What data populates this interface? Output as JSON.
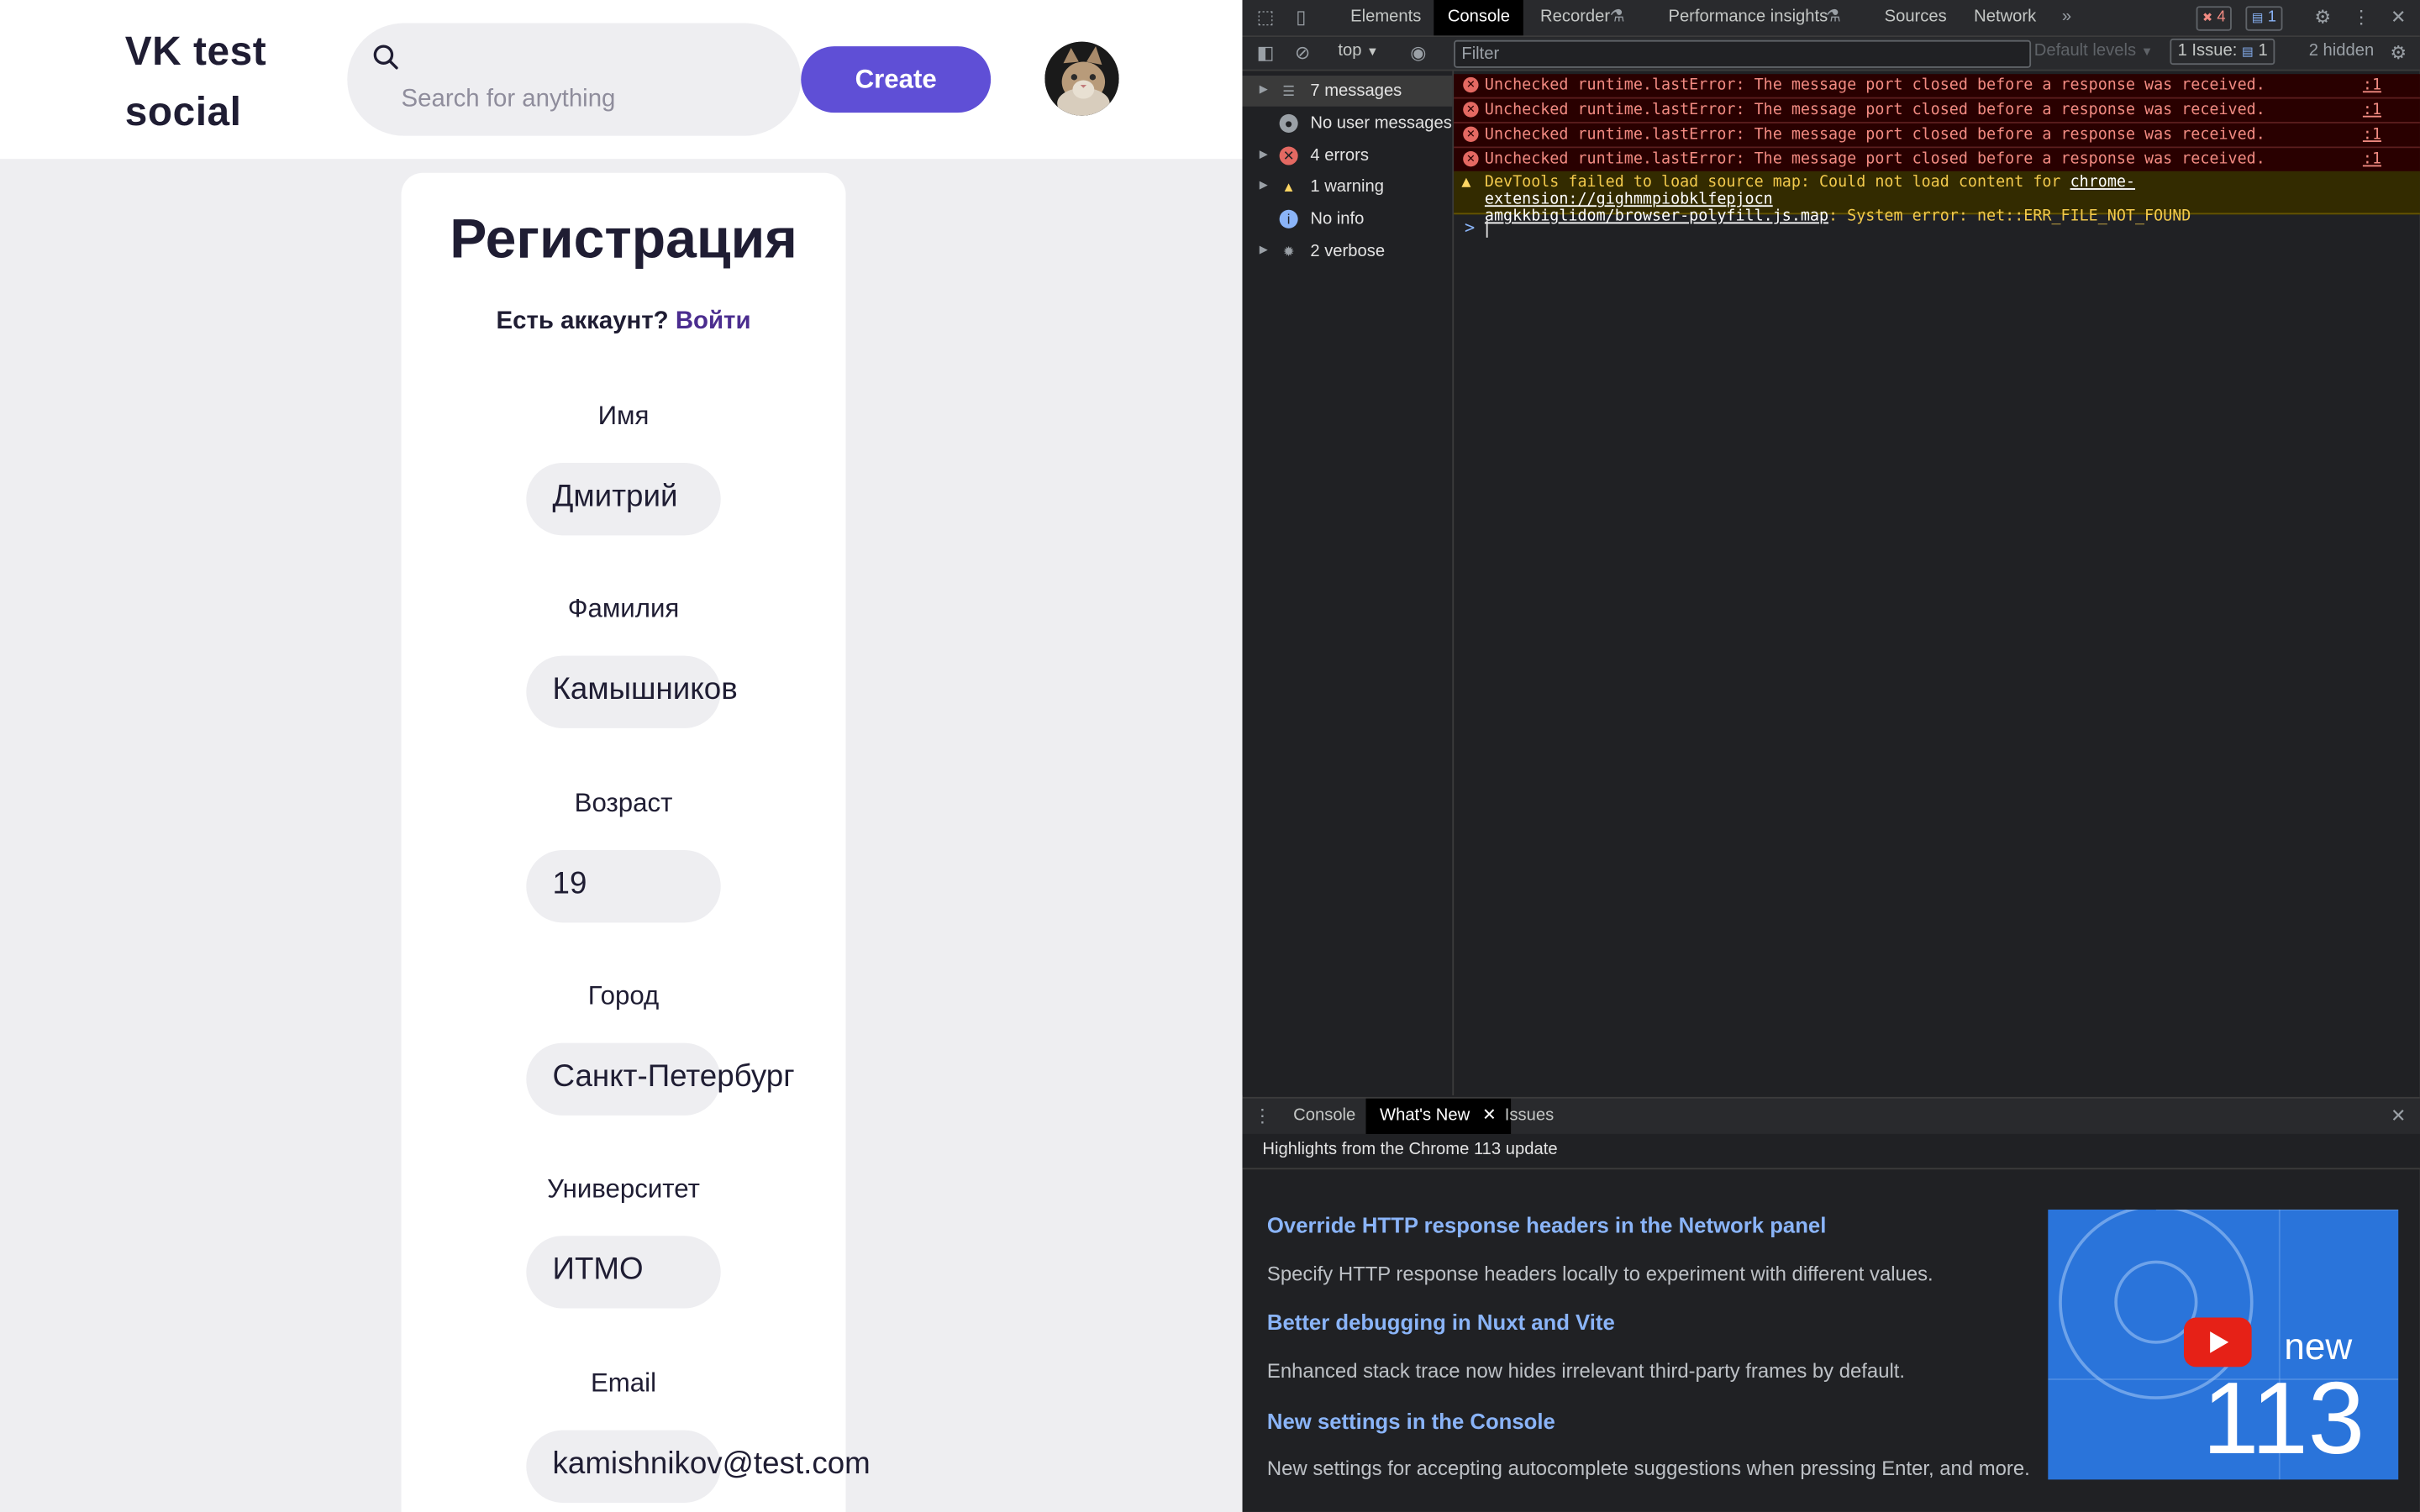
{
  "app": {
    "logo_line1": "VK test",
    "logo_line2": "social",
    "search_placeholder": "Search for anything",
    "create_label": "Create"
  },
  "registration": {
    "title": "Регистрация",
    "have_account": "Есть аккаунт?",
    "login_link": "Войти",
    "fields": [
      {
        "label": "Имя",
        "value": "Дмитрий"
      },
      {
        "label": "Фамилия",
        "value": "Камышников"
      },
      {
        "label": "Возраст",
        "value": "19"
      },
      {
        "label": "Город",
        "value": "Санкт-Петербург"
      },
      {
        "label": "Университет",
        "value": "ИТМО"
      },
      {
        "label": "Email",
        "value": "kamishnikov@test.com"
      }
    ]
  },
  "devtools": {
    "tabs": [
      "Elements",
      "Console",
      "Recorder",
      "Performance insights",
      "Sources",
      "Network"
    ],
    "more": "»",
    "error_count": "4",
    "message_count": "1",
    "context": "top",
    "filter_placeholder": "Filter",
    "levels": "Default levels",
    "issues_label": "1 Issue:",
    "issues_count": "1",
    "hidden": "2 hidden",
    "sidebar": [
      {
        "label": "7 messages",
        "icon": "list-icon"
      },
      {
        "label": "No user messages",
        "icon": "user-icon"
      },
      {
        "label": "4 errors",
        "icon": "error-icon"
      },
      {
        "label": "1 warning",
        "icon": "warning-icon"
      },
      {
        "label": "No info",
        "icon": "info-icon"
      },
      {
        "label": "2 verbose",
        "icon": "bug-icon"
      }
    ],
    "errors": [
      "Unchecked runtime.lastError: The message port closed before a response was received.",
      "Unchecked runtime.lastError: The message port closed before a response was received.",
      "Unchecked runtime.lastError: The message port closed before a response was received.",
      "Unchecked runtime.lastError: The message port closed before a response was received."
    ],
    "error_source": ":1",
    "warning_prefix": "DevTools failed to load source map: Could not load content for",
    "warning_link_1": "chrome-extension://gighmmpiobklfepjocn",
    "warning_link_2": "amgkkbiglidom/browser-polyfill.js.map",
    "warning_suffix": ": System error: net::ERR_FILE_NOT_FOUND",
    "prompt": ">",
    "drawer_tabs": [
      "Console",
      "What's New",
      "Issues"
    ],
    "highlights": "Highlights from the Chrome 113 update",
    "news": [
      {
        "title": "Override HTTP response headers in the Network panel",
        "desc": "Specify HTTP response headers locally to experiment with different values."
      },
      {
        "title": "Better debugging in Nuxt and Vite",
        "desc": "Enhanced stack trace now hides irrelevant third-party frames by default."
      },
      {
        "title": "New settings in the Console",
        "desc": "New settings for accepting autocomplete suggestions when pressing Enter, and more."
      }
    ],
    "promo_new": "new",
    "promo_version": "113"
  },
  "colors": {
    "accent": "#5f4fd6",
    "link": "#4b2d8f",
    "error_text": "#f28b82",
    "warning_text": "#f2c94c",
    "devtools_link": "#8ab4f8"
  }
}
